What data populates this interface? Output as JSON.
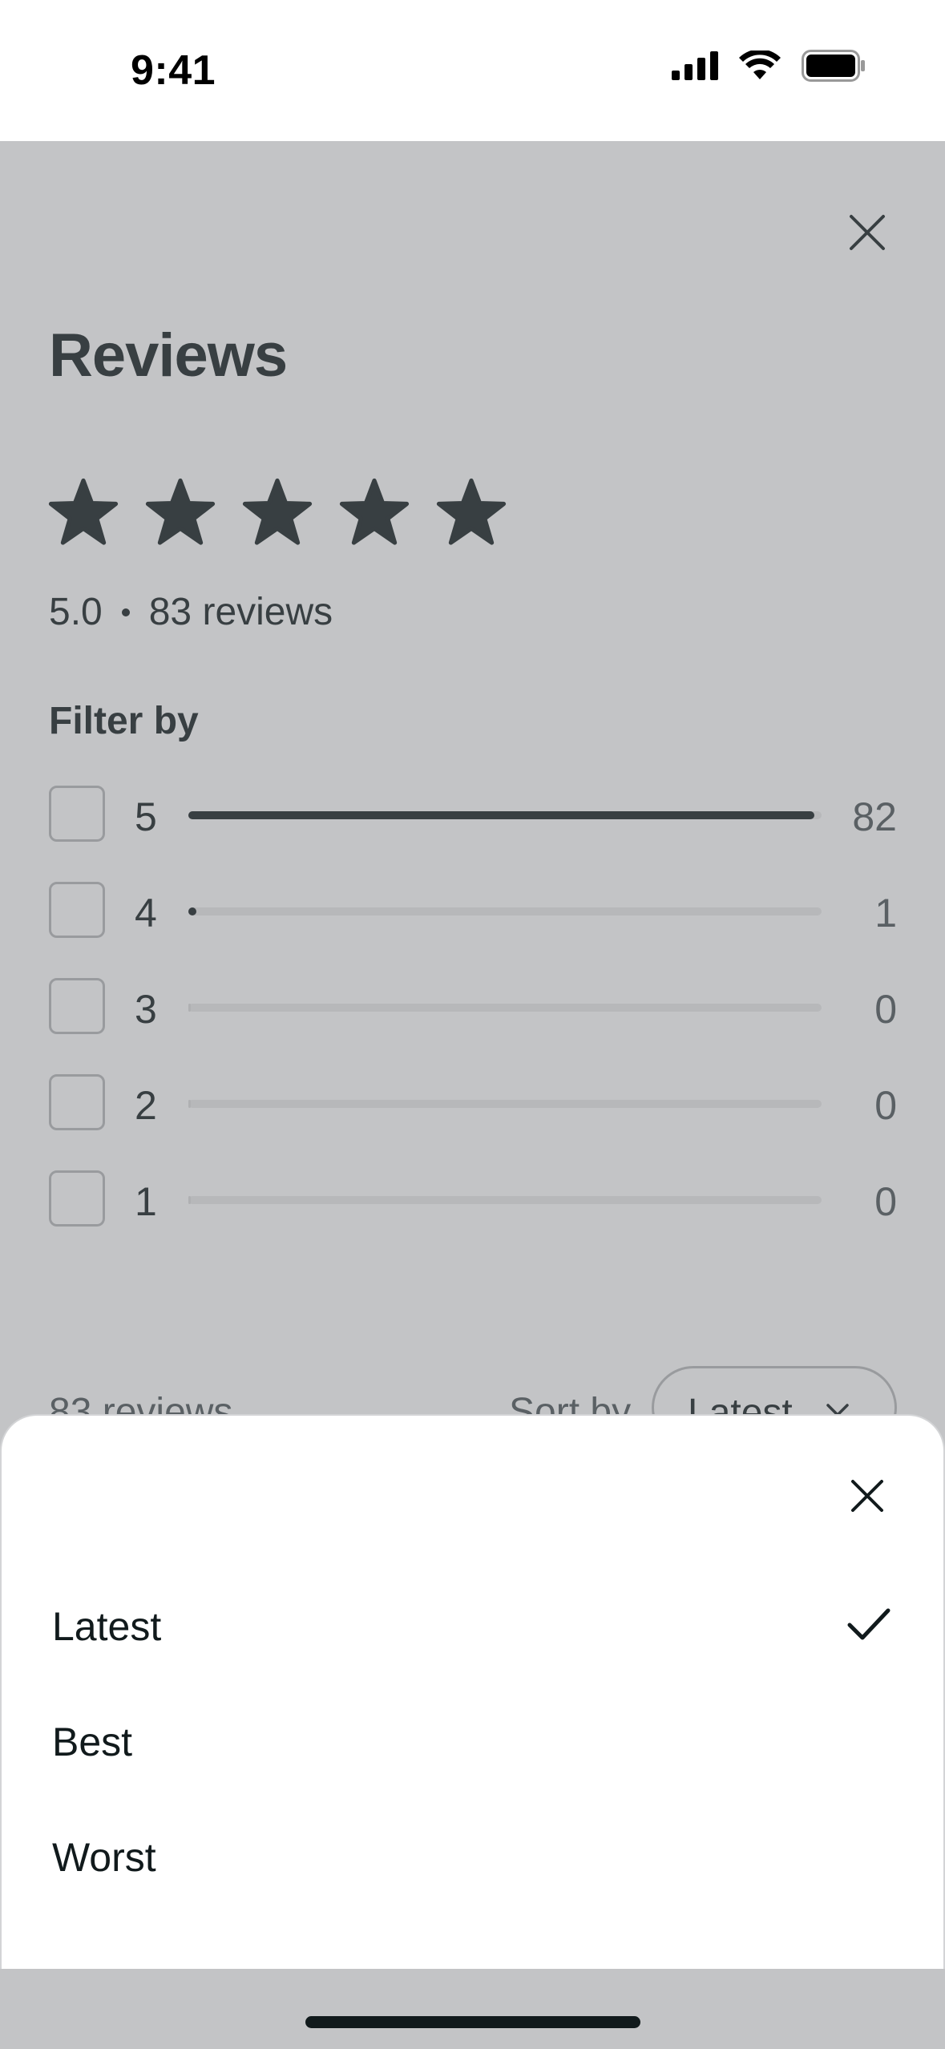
{
  "status_bar": {
    "time": "9:41"
  },
  "reviews": {
    "title": "Reviews",
    "rating": "5.0",
    "total_reviews": "83 reviews",
    "star_count": 5,
    "filter_title": "Filter by",
    "filters": [
      {
        "stars": "5",
        "count": "82",
        "fraction": 0.988
      },
      {
        "stars": "4",
        "count": "1",
        "fraction": 0.012
      },
      {
        "stars": "3",
        "count": "0",
        "fraction": 0
      },
      {
        "stars": "2",
        "count": "0",
        "fraction": 0
      },
      {
        "stars": "1",
        "count": "0",
        "fraction": 0
      }
    ],
    "list_count": "83 reviews",
    "sort_label": "Sort by",
    "sort_value": "Latest"
  },
  "sort_sheet": {
    "options": [
      {
        "label": "Latest",
        "selected": true
      },
      {
        "label": "Best",
        "selected": false
      },
      {
        "label": "Worst",
        "selected": false
      }
    ]
  },
  "icons": {
    "close": "close-icon",
    "star": "star-icon",
    "check": "checkmark-icon",
    "chevron": "chevron-down-icon"
  },
  "colors": {
    "ink": "#111a1c",
    "muted": "#4a5356",
    "scrim": "#707378"
  }
}
